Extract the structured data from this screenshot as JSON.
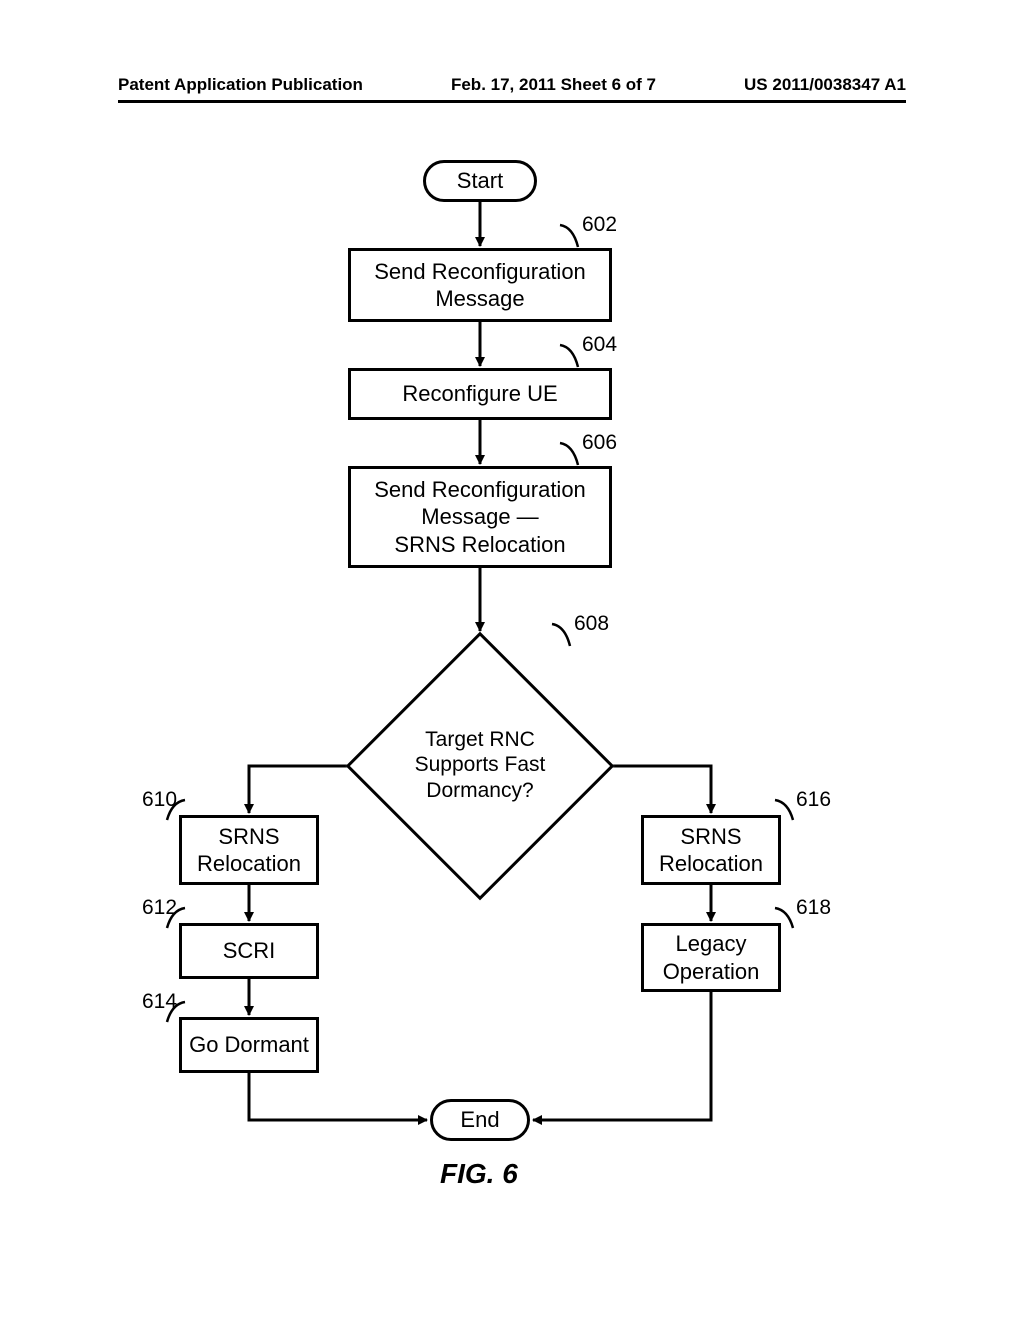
{
  "header": {
    "left": "Patent Application Publication",
    "center": "Feb. 17, 2011   Sheet 6 of 7",
    "right": "US 2011/0038347 A1"
  },
  "terminals": {
    "start": "Start",
    "end": "End"
  },
  "boxes": {
    "b602": "Send Reconfiguration\nMessage",
    "b604": "Reconfigure UE",
    "b606": "Send Reconfiguration\nMessage —\nSRNS Relocation",
    "b610": "SRNS\nRelocation",
    "b612": "SCRI",
    "b614": "Go Dormant",
    "b616": "SRNS\nRelocation",
    "b618": "Legacy\nOperation"
  },
  "decision": {
    "d608": "Target RNC\nSupports Fast\nDormancy?"
  },
  "refs": {
    "r602": "602",
    "r604": "604",
    "r606": "606",
    "r608": "608",
    "r610": "610",
    "r612": "612",
    "r614": "614",
    "r616": "616",
    "r618": "618"
  },
  "caption": "FIG. 6"
}
